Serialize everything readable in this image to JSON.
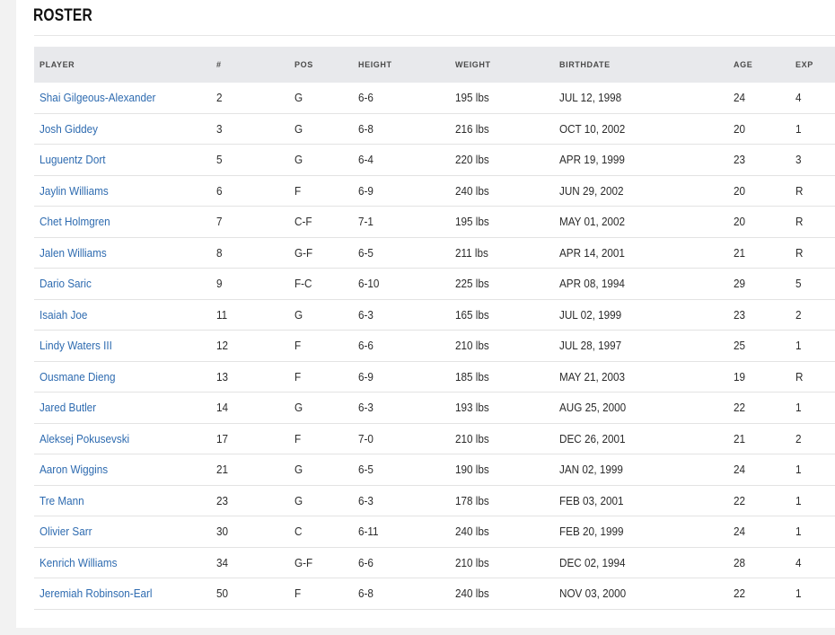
{
  "section": {
    "title": "ROSTER"
  },
  "columns": {
    "player": "PLAYER",
    "number": "#",
    "pos": "POS",
    "height": "HEIGHT",
    "weight": "WEIGHT",
    "birthdate": "BIRTHDATE",
    "age": "AGE",
    "exp": "EXP"
  },
  "players": [
    {
      "name": "Shai Gilgeous-Alexander",
      "number": "2",
      "pos": "G",
      "height": "6-6",
      "weight": "195 lbs",
      "birthdate": "JUL 12, 1998",
      "age": "24",
      "exp": "4"
    },
    {
      "name": "Josh Giddey",
      "number": "3",
      "pos": "G",
      "height": "6-8",
      "weight": "216 lbs",
      "birthdate": "OCT 10, 2002",
      "age": "20",
      "exp": "1"
    },
    {
      "name": "Luguentz Dort",
      "number": "5",
      "pos": "G",
      "height": "6-4",
      "weight": "220 lbs",
      "birthdate": "APR 19, 1999",
      "age": "23",
      "exp": "3"
    },
    {
      "name": "Jaylin Williams",
      "number": "6",
      "pos": "F",
      "height": "6-9",
      "weight": "240 lbs",
      "birthdate": "JUN 29, 2002",
      "age": "20",
      "exp": "R"
    },
    {
      "name": "Chet Holmgren",
      "number": "7",
      "pos": "C-F",
      "height": "7-1",
      "weight": "195 lbs",
      "birthdate": "MAY 01, 2002",
      "age": "20",
      "exp": "R"
    },
    {
      "name": "Jalen Williams",
      "number": "8",
      "pos": "G-F",
      "height": "6-5",
      "weight": "211 lbs",
      "birthdate": "APR 14, 2001",
      "age": "21",
      "exp": "R"
    },
    {
      "name": "Dario Saric",
      "number": "9",
      "pos": "F-C",
      "height": "6-10",
      "weight": "225 lbs",
      "birthdate": "APR 08, 1994",
      "age": "29",
      "exp": "5"
    },
    {
      "name": "Isaiah Joe",
      "number": "11",
      "pos": "G",
      "height": "6-3",
      "weight": "165 lbs",
      "birthdate": "JUL 02, 1999",
      "age": "23",
      "exp": "2"
    },
    {
      "name": "Lindy Waters III",
      "number": "12",
      "pos": "F",
      "height": "6-6",
      "weight": "210 lbs",
      "birthdate": "JUL 28, 1997",
      "age": "25",
      "exp": "1"
    },
    {
      "name": "Ousmane Dieng",
      "number": "13",
      "pos": "F",
      "height": "6-9",
      "weight": "185 lbs",
      "birthdate": "MAY 21, 2003",
      "age": "19",
      "exp": "R"
    },
    {
      "name": "Jared Butler",
      "number": "14",
      "pos": "G",
      "height": "6-3",
      "weight": "193 lbs",
      "birthdate": "AUG 25, 2000",
      "age": "22",
      "exp": "1"
    },
    {
      "name": "Aleksej Pokusevski",
      "number": "17",
      "pos": "F",
      "height": "7-0",
      "weight": "210 lbs",
      "birthdate": "DEC 26, 2001",
      "age": "21",
      "exp": "2"
    },
    {
      "name": "Aaron Wiggins",
      "number": "21",
      "pos": "G",
      "height": "6-5",
      "weight": "190 lbs",
      "birthdate": "JAN 02, 1999",
      "age": "24",
      "exp": "1"
    },
    {
      "name": "Tre Mann",
      "number": "23",
      "pos": "G",
      "height": "6-3",
      "weight": "178 lbs",
      "birthdate": "FEB 03, 2001",
      "age": "22",
      "exp": "1"
    },
    {
      "name": "Olivier Sarr",
      "number": "30",
      "pos": "C",
      "height": "6-11",
      "weight": "240 lbs",
      "birthdate": "FEB 20, 1999",
      "age": "24",
      "exp": "1"
    },
    {
      "name": "Kenrich Williams",
      "number": "34",
      "pos": "G-F",
      "height": "6-6",
      "weight": "210 lbs",
      "birthdate": "DEC 02, 1994",
      "age": "28",
      "exp": "4"
    },
    {
      "name": "Jeremiah Robinson-Earl",
      "number": "50",
      "pos": "F",
      "height": "6-8",
      "weight": "240 lbs",
      "birthdate": "NOV 03, 2000",
      "age": "22",
      "exp": "1"
    }
  ]
}
